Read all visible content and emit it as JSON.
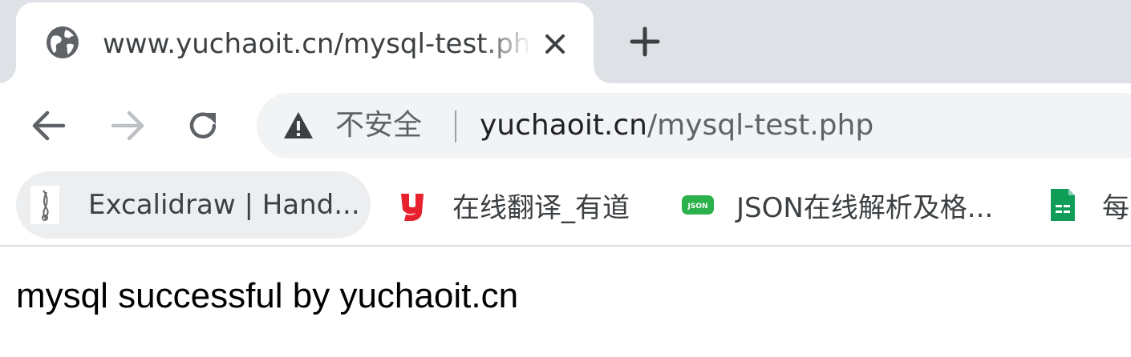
{
  "browser": {
    "tab": {
      "title": "www.yuchaoit.cn/mysql-test.php",
      "favicon": "globe-icon"
    },
    "toolbar": {
      "back_icon": "arrow-left-icon",
      "forward_icon": "arrow-right-icon",
      "reload_icon": "reload-icon"
    },
    "omnibox": {
      "security_icon": "warning-triangle-icon",
      "security_label": "不安全",
      "url_host": "yuchaoit.cn",
      "url_path": "/mysql-test.php"
    },
    "bookmarks": [
      {
        "label": "Excalidraw | Hand...",
        "icon": "excalidraw-icon"
      },
      {
        "label": "在线翻译_有道",
        "icon": "youdao-icon"
      },
      {
        "label": "JSON在线解析及格...",
        "icon": "json-icon"
      },
      {
        "label": "每",
        "icon": "sheets-icon"
      }
    ]
  },
  "page": {
    "text": "mysql successful by yuchaoit.cn"
  },
  "colors": {
    "tabstrip_bg": "#dee1e6",
    "omnibox_bg": "#f1f3f4",
    "youdao_red": "#e8212e",
    "json_green": "#2bb24c",
    "sheets_green": "#0f9d58"
  }
}
